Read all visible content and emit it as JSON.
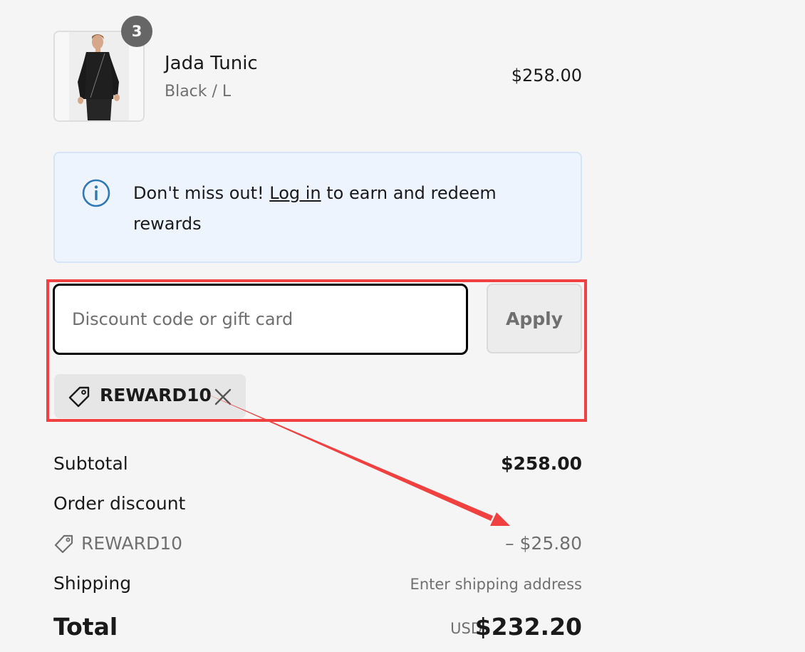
{
  "product": {
    "name": "Jada Tunic",
    "variant": "Black / L",
    "price": "$258.00",
    "quantity": "3",
    "image_icon": "product-photo"
  },
  "banner": {
    "icon": "info-icon",
    "text_before": "Don't miss out! ",
    "link": "Log in",
    "text_after": " to earn and redeem rewards"
  },
  "discount": {
    "placeholder": "Discount code or gift card",
    "value": "",
    "apply_label": "Apply",
    "applied_code": "REWARD10"
  },
  "summary": {
    "subtotal_label": "Subtotal",
    "subtotal_value": "$258.00",
    "order_discount_label": "Order discount",
    "discount_code": "REWARD10",
    "discount_value": "– $25.80",
    "shipping_label": "Shipping",
    "shipping_value": "Enter shipping address",
    "total_label": "Total",
    "total_currency": "USD",
    "total_value": "$232.20"
  },
  "colors": {
    "annotation": "#f04040",
    "banner_bg": "#eef4fe",
    "info_icon": "#2e79b5"
  }
}
